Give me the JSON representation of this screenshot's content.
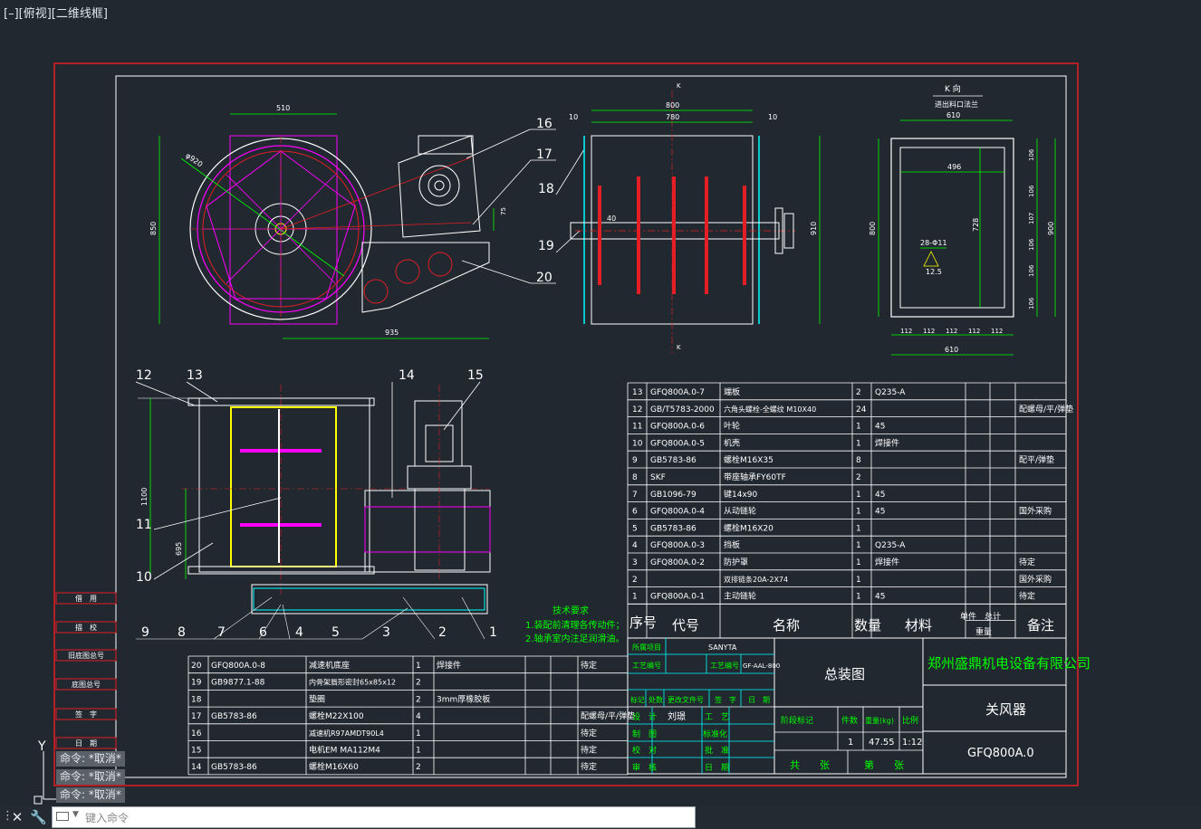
{
  "viewport_label": "[–][俯视][二维线框]",
  "drawing": {
    "part_balloons": [
      "16",
      "17",
      "18",
      "19",
      "20",
      "12",
      "13",
      "14",
      "15",
      "11",
      "10",
      "9",
      "8",
      "7",
      "6",
      "4",
      "5",
      "3",
      "2",
      "1"
    ],
    "dimensions": {
      "d510": "510",
      "d850": "850",
      "d935": "935",
      "dphi": "φ920",
      "d75": "75",
      "d10a": "10",
      "d800": "800",
      "d780": "780",
      "d10b": "10",
      "d40": "40",
      "d910": "910",
      "k1": "K",
      "k2": "K",
      "d610": "610",
      "d496": "496",
      "d900": "900",
      "d106a": "106",
      "d106b": "106",
      "d107": "107",
      "d106c": "106",
      "d106d": "106",
      "d106e": "106",
      "d728": "728",
      "d800b": "800",
      "holes": "28-Φ11",
      "d125": "12.5",
      "b1": "112",
      "b2": "112",
      "b3": "112",
      "b4": "112",
      "b5": "112",
      "d610b": "610",
      "d1100": "1100",
      "d695": "695"
    },
    "kview_title": "K 向",
    "kview_sub": "进出料口法兰",
    "tech_title": "技术要求",
    "tech_line1": "1.装配前清理各传动件；",
    "tech_line2": "2.轴承室内注足润滑油。",
    "left_stamps": [
      "借　用",
      "描　校",
      "旧底图总号",
      "底图总号",
      "签　字",
      "日　期"
    ]
  },
  "bom_right": {
    "rows": [
      [
        "13",
        "GFQ800A.0-7",
        "端板",
        "2",
        "Q235-A",
        "",
        "",
        ""
      ],
      [
        "12",
        "GB/T5783-2000",
        "六角头螺栓-全螺纹 M10X40",
        "24",
        "",
        "",
        "",
        "配螺母/平/弹垫"
      ],
      [
        "11",
        "GFQ800A.0-6",
        "叶轮",
        "1",
        "45",
        "",
        "",
        ""
      ],
      [
        "10",
        "GFQ800A.0-5",
        "机壳",
        "1",
        "焊接件",
        "",
        "",
        ""
      ],
      [
        "9",
        "GB5783-86",
        "螺栓M16X35",
        "8",
        "",
        "",
        "",
        "配平/弹垫"
      ],
      [
        "8",
        "SKF",
        "带座轴承FY60TF",
        "2",
        "",
        "",
        "",
        ""
      ],
      [
        "7",
        "GB1096-79",
        "键14x90",
        "1",
        "45",
        "",
        "",
        ""
      ],
      [
        "6",
        "GFQ800A.0-4",
        "从动链轮",
        "1",
        "45",
        "",
        "",
        "国外采购"
      ],
      [
        "5",
        "GB5783-86",
        "螺栓M16X20",
        "1",
        "",
        "",
        "",
        ""
      ],
      [
        "4",
        "GFQ800A.0-3",
        "挡板",
        "1",
        "Q235-A",
        "",
        "",
        ""
      ],
      [
        "3",
        "GFQ800A.0-2",
        "防护罩",
        "1",
        "焊接件",
        "",
        "",
        "待定"
      ],
      [
        "2",
        "",
        "双排链条20A-2X74",
        "1",
        "",
        "",
        "",
        "国外采购"
      ],
      [
        "1",
        "GFQ800A.0-1",
        "主动链轮",
        "1",
        "45",
        "",
        "",
        "待定"
      ]
    ],
    "header": {
      "seq": "序号",
      "code": "代号",
      "name": "名称",
      "qty": "数量",
      "mat": "材料",
      "unit": "单件",
      "total": "总计",
      "weight": "重量",
      "note": "备注"
    }
  },
  "bom_left": {
    "rows": [
      [
        "20",
        "GFQ800A.0-8",
        "减速机底座",
        "1",
        "焊接件",
        "",
        "",
        "待定"
      ],
      [
        "19",
        "GB9877.1-88",
        "内骨架唇形密封65x85x12",
        "2",
        "",
        "",
        "",
        ""
      ],
      [
        "18",
        "",
        "垫圈",
        "2",
        "3mm厚橡胶板",
        "",
        "",
        ""
      ],
      [
        "17",
        "GB5783-86",
        "螺栓M22X100",
        "4",
        "",
        "",
        "",
        "配螺母/平/弹垫"
      ],
      [
        "16",
        "",
        "减速机R97AMDT90L4",
        "1",
        "",
        "",
        "",
        "待定"
      ],
      [
        "15",
        "",
        "电机EM MA112M4",
        "1",
        "",
        "",
        "",
        "待定"
      ],
      [
        "14",
        "GB5783-86",
        "螺栓M16X60",
        "2",
        "",
        "",
        "",
        "待定"
      ]
    ]
  },
  "title_block": {
    "proj_label": "所属项目",
    "proj_value": "SANYTA",
    "craft_no_label": "工艺编号",
    "craft_no_label2": "工艺编号",
    "craft_no_value": "GF-AAL-800",
    "rev_labels": [
      "标记",
      "处数",
      "更改文件号",
      "签　字",
      "日　期"
    ],
    "sig_labels": [
      "设　计",
      "制　图",
      "校　对",
      "审　核"
    ],
    "sig_designer": "刘璟",
    "right_labels": [
      "工　艺",
      "标准化",
      "批　准",
      "日　期"
    ],
    "drawing_name": "总装图",
    "stage_labels": [
      "阶段标记",
      "件数",
      "重量(kg)",
      "比例"
    ],
    "qty": "1",
    "weight": "47.55",
    "scale": "1:12",
    "sheet_total": "共　　张",
    "sheet_no": "第　　张",
    "company": "郑州盛鼎机电设备有限公司",
    "product": "关风器",
    "drawing_no": "GFQ800A.0"
  },
  "command_history": [
    "命令: *取消*",
    "命令: *取消*",
    "命令: *取消*"
  ],
  "command_input_placeholder": "键入命令",
  "ucs": {
    "y": "Y"
  }
}
